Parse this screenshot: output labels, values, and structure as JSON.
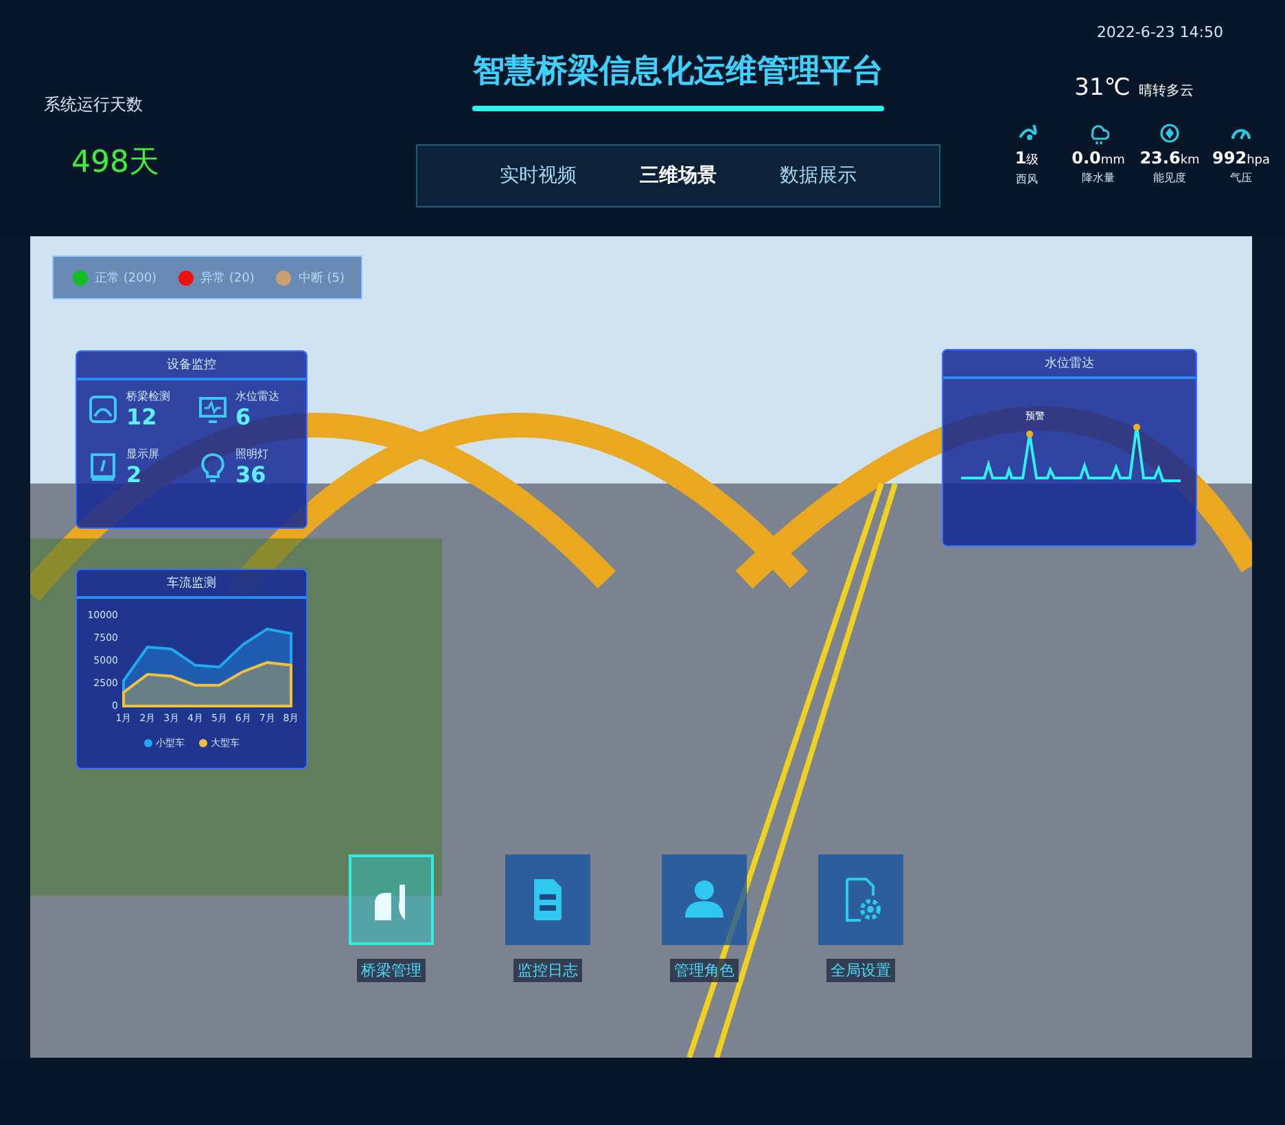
{
  "header": {
    "title": "智慧桥梁信息化运维管理平台",
    "datetime": "2022-6-23 14:50"
  },
  "runtime": {
    "label": "系统运行天数",
    "value": "498天"
  },
  "tabs": [
    {
      "label": "实时视频",
      "selected": false
    },
    {
      "label": "三维场景",
      "selected": true
    },
    {
      "label": "数据展示",
      "selected": false
    }
  ],
  "weather": {
    "temperature": "31℃",
    "condition": "晴转多云",
    "stats": [
      {
        "kind": "wind",
        "value": "1",
        "unit": "级",
        "label": "西风"
      },
      {
        "kind": "rain",
        "value": "0.0",
        "unit": "mm",
        "label": "降水量"
      },
      {
        "kind": "visibility",
        "value": "23.6",
        "unit": "km",
        "label": "能见度"
      },
      {
        "kind": "pressure",
        "value": "992",
        "unit": "hpa",
        "label": "气压"
      }
    ]
  },
  "legend": [
    {
      "label": "正常 (200)",
      "color": "#10c020"
    },
    {
      "label": "异常 (20)",
      "color": "#f01010"
    },
    {
      "label": "中断 (5)",
      "color": "#c8a070"
    }
  ],
  "device_panel": {
    "title": "设备监控",
    "items": [
      {
        "kind": "bridge",
        "label": "桥梁检测",
        "value": "12"
      },
      {
        "kind": "monitor",
        "label": "水位雷达",
        "value": "6"
      },
      {
        "kind": "screen",
        "label": "显示屏",
        "value": "2"
      },
      {
        "kind": "bulb",
        "label": "照明灯",
        "value": "36"
      }
    ]
  },
  "traffic_panel": {
    "title": "车流监测",
    "chart_data": {
      "type": "area",
      "categories": [
        "1月",
        "2月",
        "3月",
        "4月",
        "5月",
        "6月",
        "7月",
        "8月"
      ],
      "yticks": [
        0,
        2500,
        5000,
        7500,
        10000
      ],
      "ylim": [
        0,
        10000
      ],
      "legend": "bottom",
      "series": [
        {
          "name": "小型车",
          "color": "#20a8f0",
          "values": [
            2800,
            6500,
            6300,
            4500,
            4300,
            6800,
            8500,
            8000
          ]
        },
        {
          "name": "大型车",
          "color": "#f0c040",
          "values": [
            1500,
            3500,
            3300,
            2300,
            2300,
            3800,
            4800,
            4500
          ]
        }
      ]
    }
  },
  "water_panel": {
    "title": "水位雷达",
    "peak_label": "预警"
  },
  "actions": [
    {
      "kind": "bridge",
      "label": "桥梁管理",
      "selected": true
    },
    {
      "kind": "log",
      "label": "监控日志",
      "selected": false
    },
    {
      "kind": "users",
      "label": "管理角色",
      "selected": false
    },
    {
      "kind": "settings",
      "label": "全局设置",
      "selected": false
    }
  ]
}
